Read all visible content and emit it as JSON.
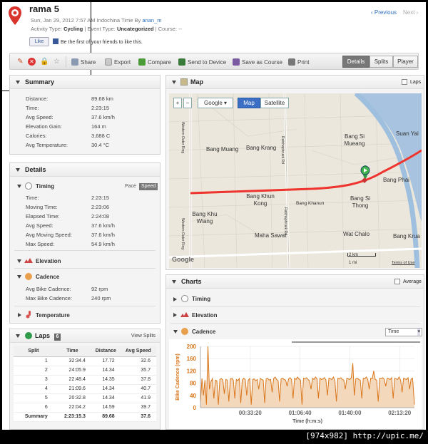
{
  "activity": {
    "title": "rama 5",
    "date_line": "Sun, Jan 29, 2012 7:57 AM Indochina Time By",
    "owner": "anan_m",
    "type_label": "Activity Type:",
    "type_value": "Cycling",
    "event_label": "| Event Type:",
    "event_value": "Uncategorized",
    "course_label": "| Course:",
    "course_value": "--"
  },
  "social": {
    "like_label": "Like",
    "like_text": "Be the first of your friends to like this."
  },
  "nav": {
    "prev": "Previous",
    "next": "Next"
  },
  "toolbar": {
    "share": "Share",
    "export": "Export",
    "compare": "Compare",
    "send": "Send to Device",
    "save_course": "Save as Course",
    "print": "Print",
    "view_details": "Details",
    "view_splits": "Splits",
    "view_player": "Player"
  },
  "summary": {
    "title": "Summary",
    "rows": [
      {
        "label": "Distance:",
        "value": "89.68 km"
      },
      {
        "label": "Time:",
        "value": "2:23:15"
      },
      {
        "label": "Avg Speed:",
        "value": "37.6 km/h"
      },
      {
        "label": "Elevation Gain:",
        "value": "164 m"
      },
      {
        "label": "Calories:",
        "value": "3,688 C"
      },
      {
        "label": "Avg Temperature:",
        "value": "30.4 °C"
      }
    ]
  },
  "details": {
    "title": "Details",
    "timing": {
      "title": "Timing",
      "pace": "Pace",
      "speed": "Speed",
      "rows": [
        {
          "label": "Time:",
          "value": "2:23:15"
        },
        {
          "label": "Moving Time:",
          "value": "2:23:06"
        },
        {
          "label": "Elapsed Time:",
          "value": "2:24:08"
        },
        {
          "label": "Avg Speed:",
          "value": "37.6 km/h"
        },
        {
          "label": "Avg Moving Speed:",
          "value": "37.6 km/h"
        },
        {
          "label": "Max Speed:",
          "value": "54.9 km/h"
        }
      ]
    },
    "elevation": {
      "title": "Elevation"
    },
    "cadence": {
      "title": "Cadence",
      "rows": [
        {
          "label": "Avg Bike Cadence:",
          "value": "92 rpm"
        },
        {
          "label": "Max Bike Cadence:",
          "value": "240 rpm"
        }
      ]
    },
    "temperature": {
      "title": "Temperature"
    }
  },
  "laps": {
    "title": "Laps",
    "count": "6",
    "view_link": "View Splits",
    "headers": [
      "Split",
      "Time",
      "Distance",
      "Avg Speed"
    ],
    "rows": [
      [
        "1",
        "32:34.4",
        "17.72",
        "32.6"
      ],
      [
        "2",
        "24:05.9",
        "14.34",
        "35.7"
      ],
      [
        "3",
        "22:48.4",
        "14.35",
        "37.8"
      ],
      [
        "4",
        "21:09.6",
        "14.34",
        "40.7"
      ],
      [
        "5",
        "20:32.8",
        "14.34",
        "41.9"
      ],
      [
        "6",
        "22:04.2",
        "14.59",
        "39.7"
      ]
    ],
    "summary": [
      "Summary",
      "2:23:15.3",
      "89.68",
      "37.6"
    ]
  },
  "map": {
    "title": "Map",
    "laps_label": "Laps",
    "provider": "Google",
    "map_btn": "Map",
    "sat_btn": "Satellite",
    "labels": [
      "Bang Muang",
      "Bang Krang",
      "Bang Si Mueang",
      "Suan Yai",
      "Bang Phai",
      "Bang Khun Kong",
      "Bang Si Thong",
      "Bang Khanun",
      "Bang Khu Wiang",
      "Maha Sawat",
      "Wat Chalo",
      "Bang Krua"
    ],
    "road_labels": [
      "Western Outer Ring",
      "Ratchaphruek Rd",
      "Ratchaphruek Rd",
      "Western Outer Ring"
    ],
    "scale_km": "2 km",
    "scale_mi": "1 mi",
    "terms": "Terms of Use",
    "brand": "Google"
  },
  "charts": {
    "title": "Charts",
    "average_label": "Average",
    "sections": [
      "Timing",
      "Elevation",
      "Cadence"
    ],
    "x_select": "Time"
  },
  "chart_data": {
    "type": "area",
    "title": "",
    "xlabel": "Time (h:m:s)",
    "ylabel": "Bike Cadence (rpm)",
    "ylim": [
      0,
      200
    ],
    "yticks": [
      "0",
      "40",
      "80",
      "120",
      "160",
      "200"
    ],
    "xticks": [
      "00:33:20",
      "01:06:40",
      "01:40:00",
      "02:13:20"
    ],
    "xlim_seconds": [
      0,
      8595
    ],
    "series": [
      {
        "color": "#d9761a",
        "x_seconds": [
          0,
          60,
          120,
          180,
          240,
          300,
          360,
          420,
          480,
          540,
          600,
          660,
          720,
          780,
          840,
          900,
          960,
          1020,
          1080,
          1140,
          1200,
          1260,
          1320,
          1380,
          1440,
          1500,
          1560,
          1620,
          1680,
          1740,
          1800,
          1860,
          1920,
          1980,
          2040,
          2100,
          2160,
          2220,
          2280,
          2340,
          2400,
          2460,
          2520,
          2580,
          2640,
          2700,
          2760,
          2820,
          2880,
          2940,
          3000,
          3060,
          3120,
          3180,
          3240,
          3300,
          3360,
          3420,
          3480,
          3540,
          3600,
          3660,
          3720,
          3780,
          3840,
          3900,
          3960,
          4020,
          4080,
          4140,
          4200,
          4260,
          4320,
          4380,
          4440,
          4500,
          4560,
          4620,
          4680,
          4740,
          4800,
          4860,
          4920,
          4980,
          5040,
          5100,
          5160,
          5220,
          5280,
          5340,
          5400,
          5460,
          5520,
          5580,
          5640,
          5700,
          5760,
          5820,
          5880,
          5940,
          6000,
          6060,
          6120,
          6180,
          6240,
          6300,
          6360,
          6420,
          6480,
          6540,
          6600,
          6660,
          6720,
          6780,
          6840,
          6900,
          6960,
          7020,
          7080,
          7140,
          7200,
          7260,
          7320,
          7380,
          7440,
          7500,
          7560,
          7620,
          7680,
          7740,
          7800,
          7860,
          7920,
          7980,
          8040,
          8100,
          8160,
          8220,
          8280,
          8340,
          8400,
          8460,
          8520,
          8595
        ],
        "values": [
          20,
          95,
          40,
          90,
          10,
          200,
          60,
          85,
          95,
          30,
          90,
          88,
          10,
          92,
          95,
          90,
          45,
          92,
          90,
          20,
          94,
          96,
          90,
          30,
          92,
          88,
          95,
          15,
          90,
          96,
          92,
          40,
          90,
          95,
          10,
          92,
          94,
          88,
          92,
          60,
          95,
          92,
          90,
          15,
          94,
          96,
          90,
          92,
          50,
          95,
          100,
          92,
          88,
          20,
          94,
          96,
          92,
          90,
          70,
          94,
          98,
          92,
          30,
          96,
          92,
          100,
          94,
          90,
          10,
          96,
          94,
          98,
          92,
          88,
          60,
          96,
          92,
          100,
          94,
          30,
          96,
          92,
          94,
          98,
          90,
          40,
          96,
          94,
          92,
          100,
          88,
          20,
          96,
          94,
          98,
          92,
          90,
          60,
          96,
          94,
          92,
          98,
          145,
          40,
          94,
          96,
          92,
          90,
          30,
          96,
          94,
          100,
          92,
          60,
          96,
          94,
          120,
          92,
          90,
          20,
          96,
          94,
          98,
          92,
          70,
          96,
          94,
          92,
          98,
          30,
          96,
          94,
          92,
          100,
          90,
          50,
          96,
          94,
          92,
          98,
          60,
          94,
          96,
          10
        ]
      }
    ]
  }
}
